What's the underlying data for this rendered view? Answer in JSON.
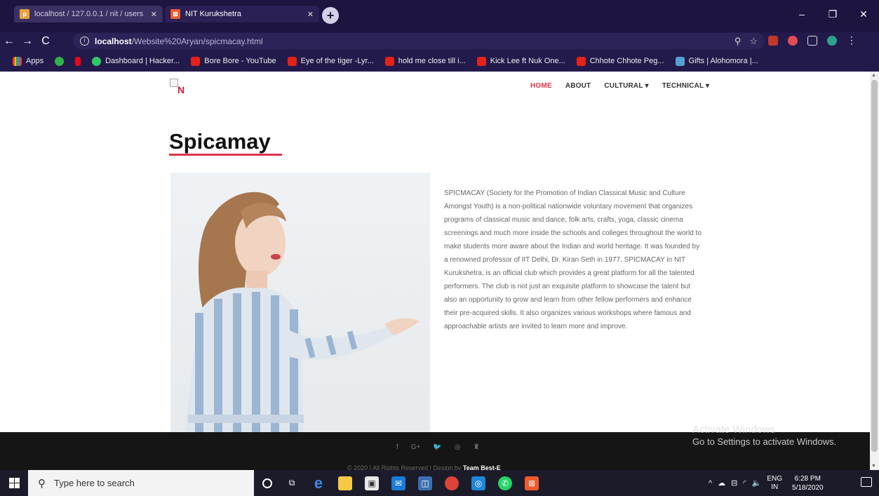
{
  "browser": {
    "tabs": [
      {
        "title": "localhost / 127.0.0.1 / nit / users",
        "active": false
      },
      {
        "title": "NIT Kurukshetra",
        "active": true
      }
    ],
    "new_tab_label": "+",
    "address": {
      "host": "localhost",
      "path": "/Website%20Aryan/spicmacay.html"
    },
    "window_controls": {
      "minimize": "–",
      "maximize": "❐",
      "close": "✕"
    },
    "bookmarks": [
      {
        "label": "Apps",
        "icon": "apps-grid-icon"
      },
      {
        "label": "",
        "icon": "play-icon"
      },
      {
        "label": "",
        "icon": "netflix-icon"
      },
      {
        "label": "Dashboard | Hacker...",
        "icon": "hackerrank-icon"
      },
      {
        "label": "Bore Bore - YouTube",
        "icon": "youtube-icon"
      },
      {
        "label": "Eye of the tiger -Lyr...",
        "icon": "youtube-icon"
      },
      {
        "label": "hold me close till i...",
        "icon": "youtube-icon"
      },
      {
        "label": "Kick Lee ft Nuk One...",
        "icon": "youtube-icon"
      },
      {
        "label": "Chhote Chhote Peg...",
        "icon": "youtube-icon"
      },
      {
        "label": "Gifts | Alohomora |...",
        "icon": "gift-icon"
      }
    ]
  },
  "site": {
    "logo_letter": "N",
    "menu": [
      {
        "label": "HOME",
        "active": true
      },
      {
        "label": "ABOUT",
        "active": false
      },
      {
        "label": "CULTURAL ▾",
        "active": false
      },
      {
        "label": "TECHNICAL ▾",
        "active": false
      }
    ],
    "title": "Spicamay",
    "description": "SPICMACAY (Society for the Promotion of Indian Classical Music and Culture Amongst Youth) is a non-political nationwide voluntary movement that organizes programs of classical music and dance, folk arts, crafts, yoga, classic cinema screenings and much more inside the schools and colleges throughout the world to make students more aware about the Indian and world heritage. It was founded by a renowned professor of IIT Delhi, Dr. Kiran Seth in 1977. SPICMACAY in NIT Kurukshetra, is an official club which provides a great platform for all the talented performers. The club is not just an exquisite platform to showcase the talent but also an opportunity to grow and learn from other fellow performers and enhance their pre-acquired skills. It also organizes various workshops where famous and approachable artists are invited to learn more and improve.",
    "footer": {
      "social": [
        "f",
        "G+",
        "🐦",
        "◎",
        "♜"
      ],
      "copyright_prefix": "© 2020 | All Rights Reserved | Design by ",
      "copyright_team": "Team Best-E"
    }
  },
  "watermark": {
    "line1": "Activate Windows",
    "line2": "Go to Settings to activate Windows."
  },
  "taskbar": {
    "search_placeholder": "Type here to search",
    "lang": {
      "line1": "ENG",
      "line2": "IN"
    },
    "clock": {
      "time": "6:28 PM",
      "date": "5/18/2020"
    }
  },
  "colors": {
    "accent": "#e0334b",
    "chrome": "#1d1440"
  }
}
